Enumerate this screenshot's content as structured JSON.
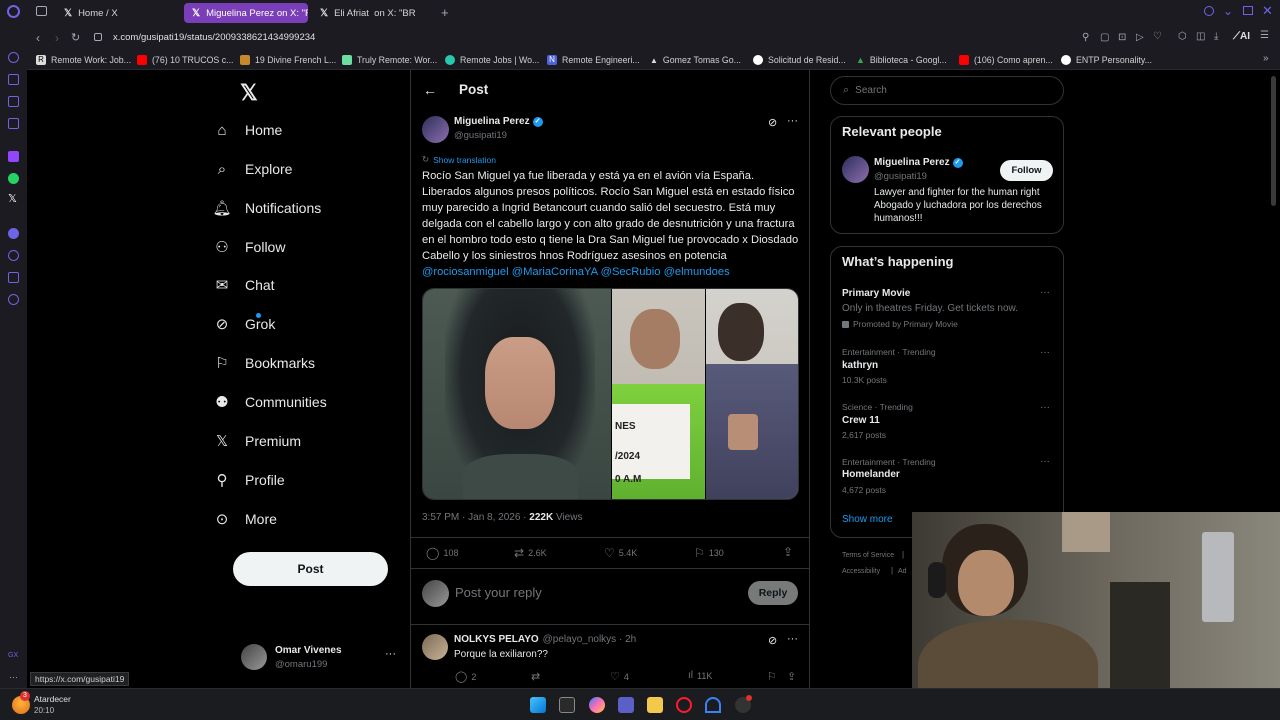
{
  "browser": {
    "tabs": [
      {
        "label": "Home / X"
      },
      {
        "label": "Miguelina Perez on X: \"Ro"
      },
      {
        "label": "Eli Afriat ‪ on X: \"‪BR"
      }
    ],
    "url": "x.com/gusipati19/status/2009338621434999234",
    "bookmarks": [
      {
        "label": "Remote Work: Job...",
        "color": "#ffffff"
      },
      {
        "label": "(76) 10 TRUCOS c...",
        "color": "#ff0000"
      },
      {
        "label": "19 Divine French L...",
        "color": "#c58a2c"
      },
      {
        "label": "Truly Remote: Wor...",
        "color": "#6ddca0"
      },
      {
        "label": "Remote Jobs | Wo...",
        "color": "#29c7b0"
      },
      {
        "label": "Remote Engineeri...",
        "color": "#4f63d8"
      },
      {
        "label": "Gomez Tomas Go...",
        "color": "#dddddd"
      },
      {
        "label": "Solicitud de Resid...",
        "color": "#ffffff"
      },
      {
        "label": "Biblioteca - Googl...",
        "color": "#34a853"
      },
      {
        "label": "(106) Como apren...",
        "color": "#ff0000"
      },
      {
        "label": "ENTP Personality...",
        "color": "#ffffff"
      }
    ],
    "status_url": "https://x.com/gusipati19",
    "ai_label": "AI"
  },
  "nav": {
    "items": [
      {
        "label": "Home",
        "icon": "home-icon"
      },
      {
        "label": "Explore",
        "icon": "search-icon"
      },
      {
        "label": "Notifications",
        "icon": "bell-icon"
      },
      {
        "label": "Follow",
        "icon": "person-plus-icon"
      },
      {
        "label": "Chat",
        "icon": "mail-icon"
      },
      {
        "label": "Grok",
        "icon": "grok-icon"
      },
      {
        "label": "Bookmarks",
        "icon": "bookmark-icon"
      },
      {
        "label": "Communities",
        "icon": "people-icon"
      },
      {
        "label": "Premium",
        "icon": "x-logo-icon"
      },
      {
        "label": "Profile",
        "icon": "person-icon"
      },
      {
        "label": "More",
        "icon": "more-circle-icon"
      }
    ],
    "post_button": "Post",
    "account": {
      "name": "Omar Vivenes",
      "handle": "@omaru199"
    }
  },
  "post": {
    "header_title": "Post",
    "author_name": "Miguelina Perez",
    "author_handle": "@gusipati19",
    "show_translation": "Show translation",
    "text": "Rocío San Miguel ya fue liberada y está ya en el avión vía España. Liberados algunos presos políticos.  Rocío San Miguel está en estado físico muy parecido a Ingrid Betancourt cuando salió del secuestro. Está muy delgada con el cabello largo y con alto grado de desnutrición y una fractura en el hombro todo esto q tiene la Dra San Miguel fue provocado x Diosdado Cabello y  los siniestros hnos Rodríguez asesinos en potencia",
    "mentions": [
      "@rociosanmiguel",
      "@MariaCorinaYA",
      "@SecRubio",
      "@elmundoes"
    ],
    "image_texts": [
      "NES",
      "/2024",
      "0 A.M"
    ],
    "time": "3:57 PM · Jan 8, 2026 · ",
    "views_count": "222K",
    "views_label": " Views",
    "stats": {
      "replies": "108",
      "reposts": "2.6K",
      "likes": "5.4K",
      "bookmarks": "130"
    },
    "reply_placeholder": "Post your reply",
    "reply_button": "Reply"
  },
  "reply": {
    "name": "NOLKYS PELAYO",
    "handle": "@pelayo_nolkys · 2h",
    "text": "Porque la exiliaron??",
    "stats": {
      "replies": "2",
      "likes": "4",
      "views": "11K"
    }
  },
  "sidebar": {
    "search_placeholder": "Search",
    "relevant_title": "Relevant people",
    "person": {
      "name": "Miguelina Perez",
      "handle": "@gusipati19",
      "bio": "Lawyer and fighter for the human right Abogado y luchadora por los derechos humanos!!!",
      "follow": "Follow"
    },
    "happening_title": "What’s happening",
    "trends": [
      {
        "meta": "",
        "title": "Primary Movie",
        "sub": "Only in theatres Friday. Get tickets now.",
        "promo": "Promoted by Primary Movie"
      },
      {
        "meta": "Entertainment · Trending",
        "title": "kathryn",
        "sub": "10.3K posts"
      },
      {
        "meta": "Science · Trending",
        "title": "Crew 11",
        "sub": "2,617 posts"
      },
      {
        "meta": "Entertainment · Trending",
        "title": "Homelander",
        "sub": "4,672 posts"
      }
    ],
    "show_more": "Show more",
    "footer": [
      "Terms of Service",
      "Accessibility",
      "Ad"
    ]
  },
  "taskbar": {
    "weather_title": "Atardecer",
    "time": "20:10",
    "badge": "3"
  }
}
